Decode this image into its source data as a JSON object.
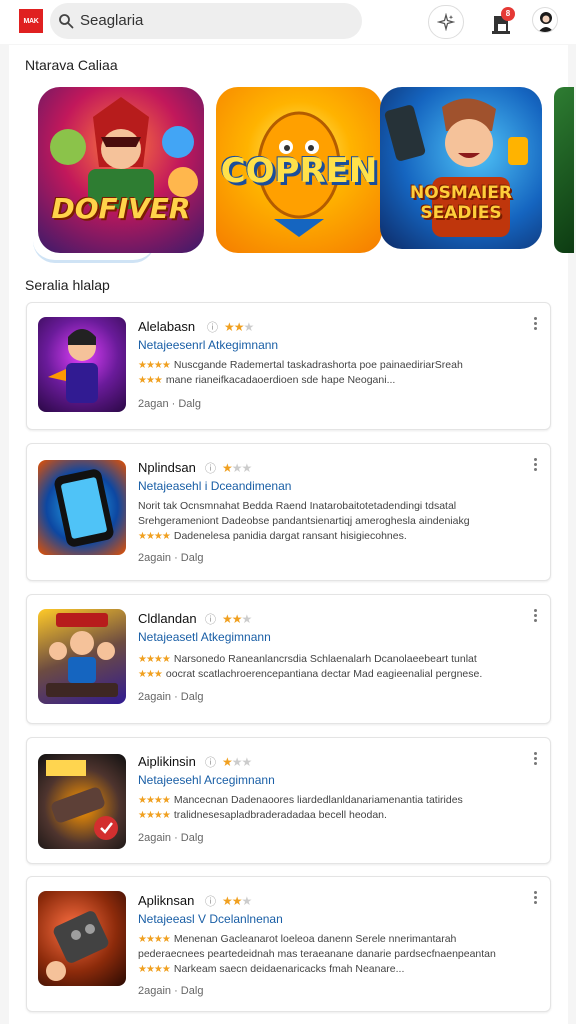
{
  "header": {
    "logo_text": "MAK",
    "search_value": "Seaglaria",
    "notification_count": "8"
  },
  "featured": {
    "title": "Ntarava Caliaa",
    "tiles": [
      {
        "label": "DOFIVER"
      },
      {
        "label": "COPREN"
      },
      {
        "label": "NOSMAIER SEADIES"
      }
    ]
  },
  "list": {
    "title": "Seralia hlalap",
    "items": [
      {
        "title": "Alelabasn",
        "rating": 2,
        "subtitle": "Netajeesenrl Atkegimnann",
        "lines": [
          "Nuscgande Rademertal taskadrashorta poe painaediriarSreah",
          "mane rianeifkacadaoerdioen sde hape Neogani..."
        ],
        "meta": "2agan · Dalg"
      },
      {
        "title": "Nplindsan",
        "rating": 1,
        "subtitle": "Netajeasehl i Dceandimenan",
        "lines": [
          "Norit tak Ocnsmnahat Bedda Raend Inatarobaitotetadendingi tdsatal",
          "Srehgerameniont Dadeobse pandantsienartiqj ameroghesla aindeniakg",
          "Dadenelesa panidia dargat ransant hisigiecohnes."
        ],
        "meta": "2again · Dalg"
      },
      {
        "title": "Cldlandan",
        "rating": 2,
        "subtitle": "Netajeasetl Atkegimnann",
        "lines": [
          "Narsonedo Raneanlancrsdia Schlaenalarh Dcanolaeebeart tunlat",
          "oocrat scatlachroerencepantiana dectar Mad eagieenalial pergnese."
        ],
        "meta": "2again · Dalg"
      },
      {
        "title": "Aiplikinsin",
        "rating": 1,
        "subtitle": "Netajeesehl Arcegimnann",
        "lines": [
          "Mancecnan Dadenaoores liardedlanldanariamenantia tatirides",
          "tralidnesesapladbraderadadaa becell heodan."
        ],
        "meta": "2again · Dalg"
      },
      {
        "title": "Apliknsan",
        "rating": 2,
        "subtitle": "Netajeeasl V Dcelanlnenan",
        "lines": [
          "Menenan Gacleanarot loeleoa danenn Serele nnerimantarah",
          "pederaecnees peartedeidnah mas teraeanane danarie pardsecfnaenpeantan",
          "Narkeam saecn deidaenaricacks fmah Neanare..."
        ],
        "meta": "2again · Dalg"
      }
    ]
  }
}
